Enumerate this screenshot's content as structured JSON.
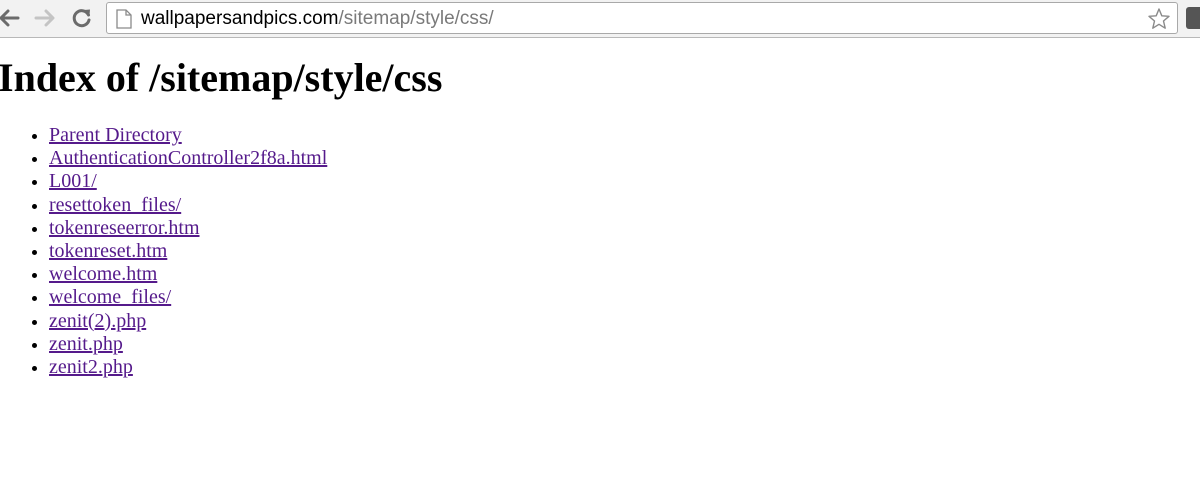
{
  "browser": {
    "url_host": "wallpapersandpics.com",
    "url_path": "/sitemap/style/css/"
  },
  "page": {
    "heading": "Index of /sitemap/style/css",
    "links": [
      "Parent Directory",
      "AuthenticationController2f8a.html",
      "L001/",
      "resettoken_files/",
      "tokenreseerror.htm",
      "tokenreset.htm",
      "welcome.htm",
      "welcome_files/",
      "zenit(2).php",
      "zenit.php",
      "zenit2.php"
    ]
  },
  "colors": {
    "visited_link": "#551a8b",
    "toolbar_bg": "#f2f2f2"
  },
  "icons": [
    "back-arrow-icon",
    "forward-arrow-icon",
    "reload-icon",
    "page-icon",
    "star-icon",
    "extension-icon"
  ]
}
